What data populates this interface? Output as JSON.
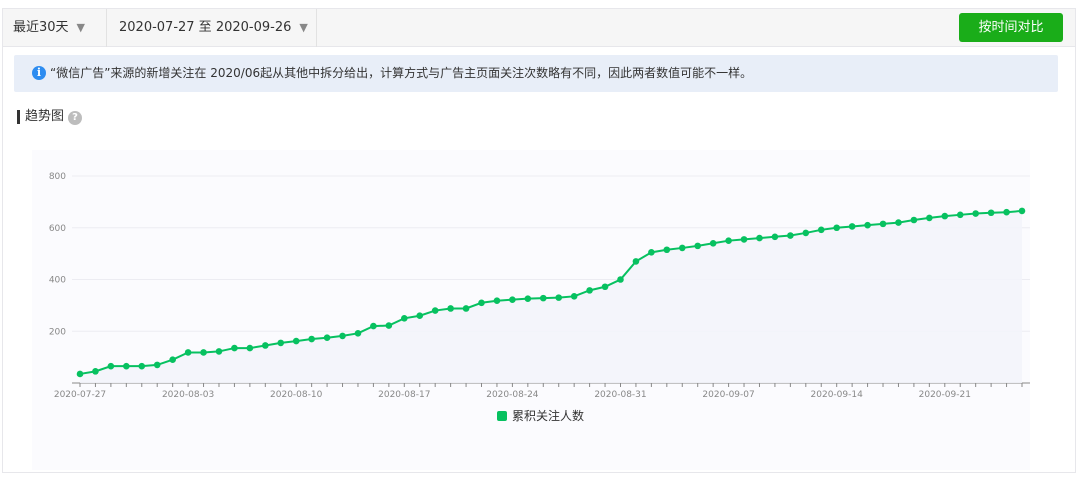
{
  "toolbar": {
    "period_label": "最近30天",
    "range_label": "2020-07-27 至 2020-09-26",
    "compare_button": "按时间对比"
  },
  "notice": {
    "icon": "info-icon",
    "text": "“微信广告”来源的新增关注在 2020/06起从其他中拆分给出，计算方式与广告主页面关注次数略有不同，因此两者数值可能不一样。"
  },
  "trend": {
    "title": "趋势图",
    "help_icon": "?"
  },
  "colors": {
    "accent": "#1aad19",
    "series": "#07c160",
    "notice_bg": "#e8eef8"
  },
  "chart_data": {
    "type": "line",
    "x_ticks": [
      "2020-07-27",
      "2020-08-03",
      "2020-08-10",
      "2020-08-17",
      "2020-08-24",
      "2020-08-31",
      "2020-09-07",
      "2020-09-14",
      "2020-09-21"
    ],
    "y_ticks": [
      200,
      400,
      600,
      800
    ],
    "ylim": [
      0,
      800
    ],
    "grid": true,
    "legend_position": "bottom",
    "series": [
      {
        "name": "累积关注人数",
        "values": [
          35,
          45,
          65,
          65,
          65,
          70,
          90,
          118,
          118,
          122,
          135,
          135,
          145,
          155,
          162,
          170,
          175,
          182,
          192,
          220,
          222,
          250,
          260,
          280,
          288,
          288,
          310,
          318,
          322,
          326,
          328,
          330,
          335,
          358,
          372,
          400,
          470,
          505,
          515,
          522,
          530,
          540,
          550,
          555,
          560,
          565,
          570,
          580,
          592,
          600,
          605,
          610,
          615,
          620,
          630,
          638,
          645,
          650,
          655,
          658,
          660,
          665
        ]
      }
    ]
  }
}
